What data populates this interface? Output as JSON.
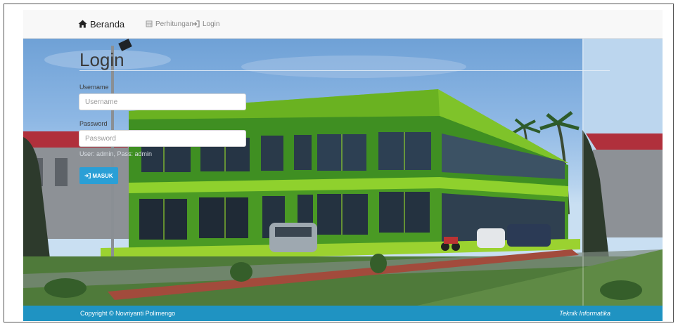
{
  "navbar": {
    "brand_label": "Beranda",
    "items": [
      {
        "label": "Perhitungan",
        "icon": "calculator-icon"
      },
      {
        "label": "Login",
        "icon": "sign-in-icon"
      }
    ],
    "brand_icon": "home-icon"
  },
  "login": {
    "title": "Login",
    "username_label": "Username",
    "username_placeholder": "Username",
    "password_label": "Password",
    "password_placeholder": "Password",
    "hint": "User: admin, Pass: admin",
    "submit_label": "MASUK",
    "submit_icon": "sign-in-icon"
  },
  "footer": {
    "copyright": "Copyright © Novriyanti Polimengo",
    "right_text": "Teknik Informatika"
  },
  "colors": {
    "footer": "#1f93c2",
    "button": "#2a9fd6",
    "navbar": "#f8f8f8",
    "building": "#7ed321"
  }
}
